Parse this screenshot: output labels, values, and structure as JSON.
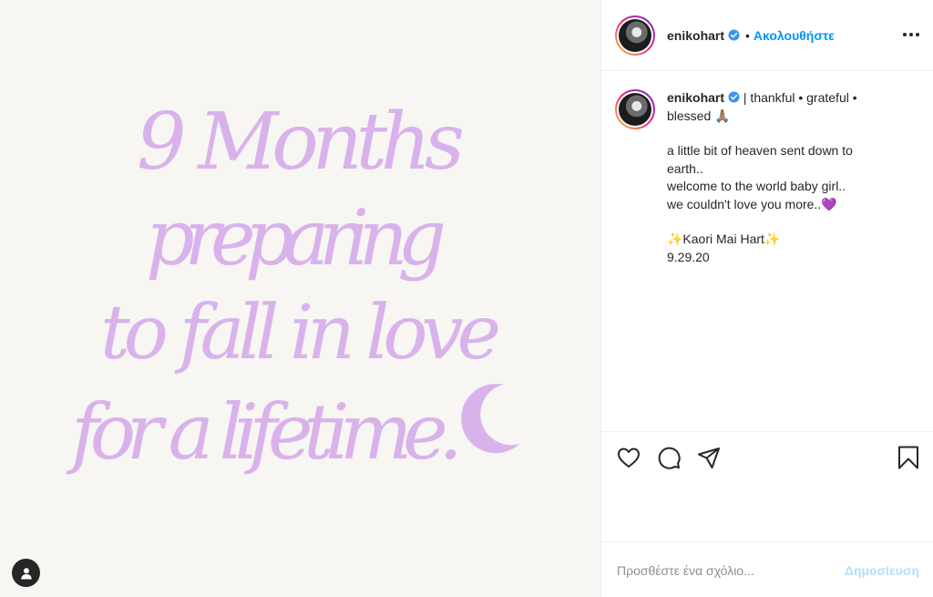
{
  "media": {
    "quote_lines": [
      "9 Months",
      "preparing",
      "to fall in love",
      "for a lifetime."
    ],
    "text_color": "#d9b2ec",
    "background_color": "#f7f6f2",
    "moon_icon": "crescent-moon",
    "user_tag_icon": "person-icon"
  },
  "header": {
    "username": "enikohart",
    "dot": "•",
    "follow_label": "Ακολουθήστε",
    "verified_icon": "verified-badge",
    "more_icon": "more-horizontal-icon"
  },
  "caption": {
    "username": "enikohart",
    "lines": [
      "| thankful • grateful •",
      "blessed 🙏🏽",
      "a little bit of heaven sent down to",
      "earth..",
      "welcome to the world baby girl..",
      "we couldn't love you more..💜",
      "✨Kaori Mai Hart✨",
      "9.29.20"
    ]
  },
  "actions": {
    "like_icon": "heart-icon",
    "comment_icon": "comment-icon",
    "share_icon": "paper-plane-icon",
    "save_icon": "bookmark-icon"
  },
  "comment_box": {
    "placeholder": "Προσθέστε ένα σχόλιο...",
    "post_label": "Δημοσίευση"
  },
  "colors": {
    "accent": "#0095f6",
    "post_disabled": "#b2dffc",
    "verified": "#3897f0"
  }
}
